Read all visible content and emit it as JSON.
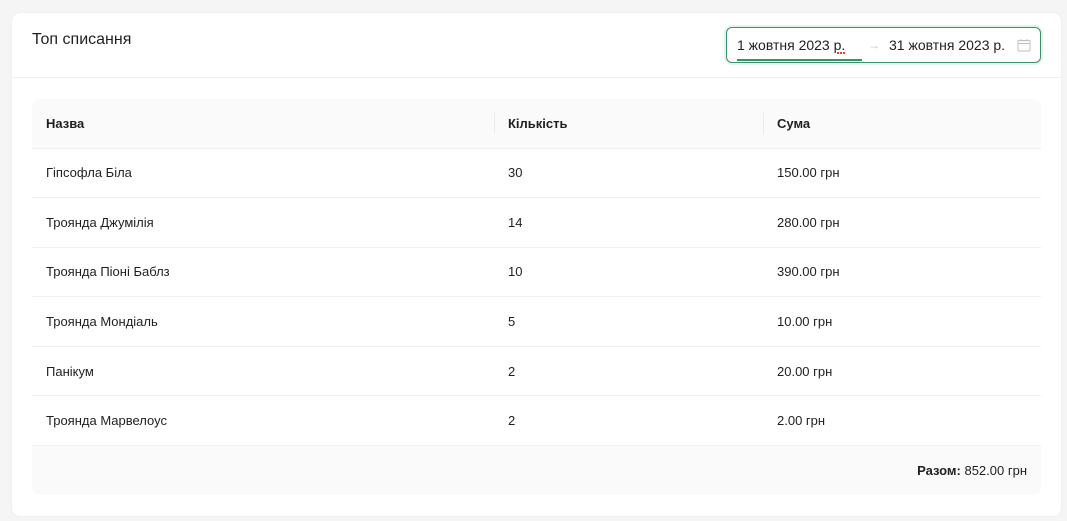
{
  "card": {
    "title": "Топ списання"
  },
  "date_range": {
    "start": "1 жовтня 2023 р.",
    "separator": "→",
    "end": "31 жовтня 2023 р.",
    "icon": "calendar-icon",
    "accent_color": "#3f8f68"
  },
  "table": {
    "columns": [
      "Назва",
      "Кількість",
      "Сума"
    ],
    "rows": [
      [
        "Гіпсофла Біла",
        "30",
        "150.00 грн"
      ],
      [
        "Троянда Джумілія",
        "14",
        "280.00 грн"
      ],
      [
        "Троянда Піоні Баблз",
        "10",
        "390.00 грн"
      ],
      [
        "Троянда Мондіаль",
        "5",
        "10.00 грн"
      ],
      [
        "Панікум",
        "2",
        "20.00 грн"
      ],
      [
        "Троянда Марвелоус",
        "2",
        "2.00 грн"
      ]
    ],
    "summary_label": "Разом:",
    "summary_value": "852.00 грн"
  }
}
